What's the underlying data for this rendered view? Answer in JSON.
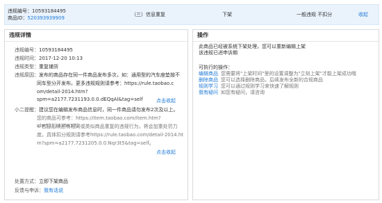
{
  "header": {
    "violation_no_label": "违规编号：",
    "violation_no": "10593184495",
    "item_id_label": "商品ID：",
    "item_id": "520393939909",
    "type": "（三）信息重复",
    "action": "下架",
    "severity": "一般违规 不扣分",
    "collapse": "收起"
  },
  "detail": {
    "title": "违规详情",
    "rows": [
      {
        "label": "违规编号：",
        "value": "10593184495"
      },
      {
        "label": "违规时间：",
        "value": "2017-12-20 10:13"
      },
      {
        "label": "违规类型：",
        "value": "重复铺货"
      }
    ],
    "reason_label": "违规原因：",
    "reason_lines": [
      "发布的商品存在同一件商品发布多次，如：通用型的汽车座垫按不",
      "同车型分开发布。更多违规规则请参考：https://rule.taobao.c",
      "om/detail-2014.htm?spm=a2177.7231193.0.0.dEQqAl&tag=self"
    ],
    "reason_toggle": "点击收起",
    "tip_label": "小二提醒：",
    "tip_lines": [
      "建议您在编辑发布商品信息时，同一件商品请勿发布2次及以上。",
      "您的商品可参考：https://item.taobao.com/item.htm?id=52138354372",
      "4 若您后续还有相同或类似商品重复的违规行为，将会加重处罚力",
      "度。具体扣分规则请参考https://rule.taobao.com/detail-2014.ht",
      "m?spm=a2177.7231205.0.0.Nqr3t5&tag=self。"
    ],
    "tip_toggle": "点击收起",
    "handle_label": "处置方式：",
    "handle_value": "立即下架商品",
    "appeal_label": "反馈与申诉：",
    "appeal_link": "我有话说"
  },
  "ops": {
    "title": "操作",
    "notice_lines": [
      "此商品已经被系统下架处理，您可以重新编辑上架",
      "该违规已进申诉期"
    ],
    "available_label": "可执行的操作：",
    "items": [
      {
        "link": "编辑商品",
        "text": "您需要将\"上架时间\"里的设置调整为\"立刻上架\"才能上架成功哦"
      },
      {
        "link": "删除商品",
        "text": "您可以选择删除商品，后续发布全新的合规商品"
      },
      {
        "link": "规则学习",
        "text": "您可以通过规则学习来快速了解规则"
      },
      {
        "link": "我有疑问",
        "text": "如您有疑问，请咨询"
      }
    ]
  }
}
